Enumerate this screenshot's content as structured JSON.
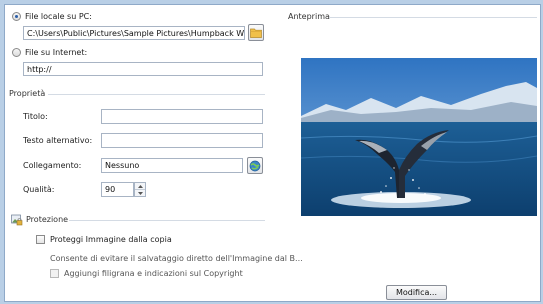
{
  "source": {
    "local_file_label": "File locale su PC:",
    "local_file_path": "C:\\Users\\Public\\Pictures\\Sample Pictures\\Humpback Whale.jpg",
    "internet_file_label": "File su Internet:",
    "internet_url": "http://"
  },
  "properties": {
    "section_title": "Proprietà",
    "title_label": "Titolo:",
    "title_value": "",
    "alt_label": "Testo alternativo:",
    "alt_value": "",
    "link_label": "Collegamento:",
    "link_value": "Nessuno",
    "quality_label": "Qualità:",
    "quality_value": "90"
  },
  "protection": {
    "section_title": "Protezione",
    "protect_copy_label": "Proteggi Immagine dalla copia",
    "description": "Consente di evitare il salvataggio diretto dell'Immagine dal B...",
    "watermark_label": "Aggiungi filigrana e indicazioni sul Copyright"
  },
  "preview": {
    "section_title": "Anteprima",
    "modify_button": "Modifica..."
  },
  "colors": {
    "accent": "#2a5ea8",
    "frame": "#b9cfe6"
  },
  "icons": {
    "browse": "folder-icon",
    "link": "globe-link-icon",
    "protection": "lock-image-icon"
  }
}
